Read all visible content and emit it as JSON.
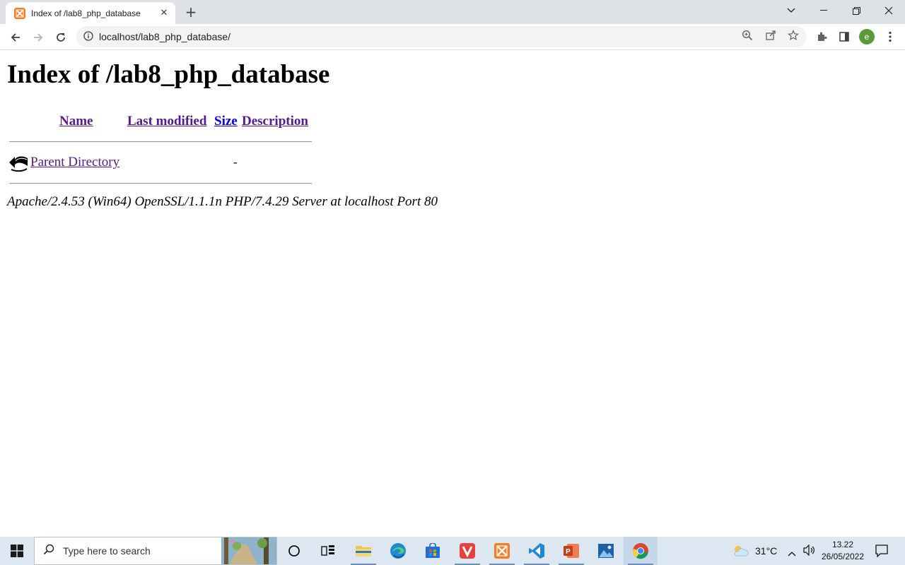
{
  "browser": {
    "tab": {
      "title": "Index of /lab8_php_database"
    },
    "address_bar": {
      "url": "localhost/lab8_php_database/"
    },
    "profile_initial": "e"
  },
  "page": {
    "heading": "Index of /lab8_php_database",
    "columns": [
      "Name",
      "Last modified",
      "Size",
      "Description"
    ],
    "rows": [
      {
        "name": "Parent Directory",
        "last_modified": "",
        "size": "-",
        "description": ""
      }
    ],
    "server_signature": "Apache/2.4.53 (Win64) OpenSSL/1.1.1n PHP/7.4.29 Server at localhost Port 80"
  },
  "taskbar": {
    "search_placeholder": "Type here to search",
    "apps": [
      "task-view",
      "file-explorer",
      "edge",
      "store",
      "vivaldi",
      "xampp",
      "vscode",
      "powerpoint",
      "photos",
      "chrome"
    ],
    "weather": "31°C",
    "time": "13.22",
    "date": "26/05/2022"
  },
  "colors": {
    "tabstrip": "#dee1e6",
    "taskbar": "#dce7f2",
    "visited_link": "#551a8b",
    "link": "#0000ee"
  }
}
